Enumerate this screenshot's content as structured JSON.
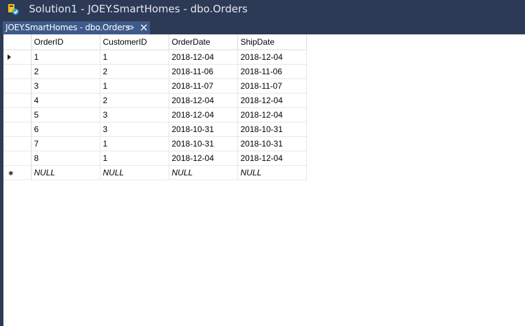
{
  "window": {
    "title": "Solution1 - JOEY.SmartHomes - dbo.Orders"
  },
  "tab": {
    "label": "JOEY.SmartHomes - dbo.Orders",
    "pin_icon": "pin-icon",
    "close_icon": "close-icon"
  },
  "table": {
    "columns": [
      "OrderID",
      "CustomerID",
      "OrderDate",
      "ShipDate"
    ],
    "rows": [
      [
        "1",
        "1",
        "2018-12-04",
        "2018-12-04"
      ],
      [
        "2",
        "2",
        "2018-11-06",
        "2018-11-06"
      ],
      [
        "3",
        "1",
        "2018-11-07",
        "2018-11-07"
      ],
      [
        "4",
        "2",
        "2018-12-04",
        "2018-12-04"
      ],
      [
        "5",
        "3",
        "2018-12-04",
        "2018-12-04"
      ],
      [
        "6",
        "3",
        "2018-10-31",
        "2018-10-31"
      ],
      [
        "7",
        "1",
        "2018-10-31",
        "2018-10-31"
      ],
      [
        "8",
        "1",
        "2018-12-04",
        "2018-12-04"
      ]
    ],
    "new_row": [
      "NULL",
      "NULL",
      "NULL",
      "NULL"
    ],
    "current_row_indicator": "arrow-right-icon",
    "new_row_indicator": "asterisk-icon"
  },
  "colors": {
    "titlebar": "#2d3a56",
    "tab_active": "#3e5a8a",
    "grid_background": "#ffffff"
  }
}
